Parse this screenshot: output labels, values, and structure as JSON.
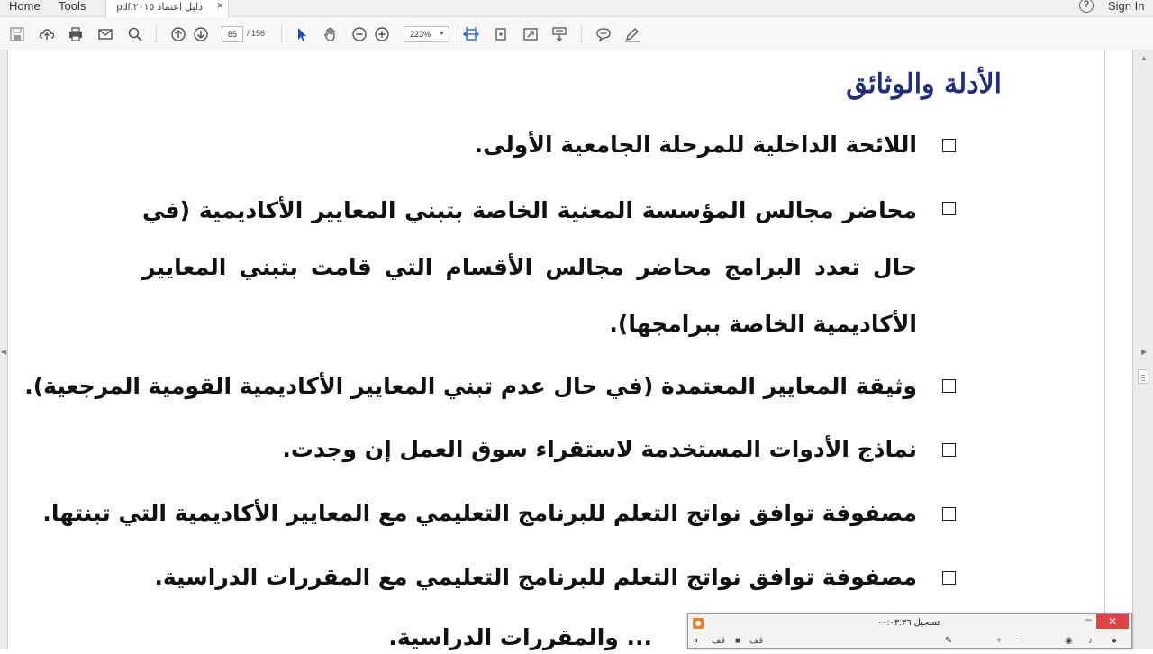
{
  "menubar": {
    "home": "Home",
    "tools": "Tools",
    "tab_title": "دليل اعتماد ٢٠١٥.pdf",
    "tab_close": "×",
    "help": "?",
    "sign_in": "Sign In"
  },
  "toolbar": {
    "page_current": "85",
    "page_total": "/ 156",
    "zoom": "223%",
    "zoom_caret": "▼"
  },
  "document": {
    "heading": "الأدلة والوثائق",
    "items": [
      "اللائحة الداخلية للمرحلة الجامعية الأولى.",
      "محاضر مجالس المؤسسة المعنية الخاصة بتبني المعايير الأكاديمية (في حال تعدد البرامج محاضر مجالس الأقسام التي قامت بتبني المعايير الأكاديمية الخاصة ببرامجها).",
      "وثيقة المعايير المعتمدة (في حال عدم تبني المعايير الأكاديمية القومية المرجعية).",
      "نماذج الأدوات المستخدمة لاستقراء سوق العمل إن وجدت.",
      "مصفوفة توافق نواتج التعلم للبرنامج التعليمي مع المعايير الأكاديمية التي تبنتها.",
      "مصفوفة توافق نواتج التعلم للبرنامج التعليمي مع المقررات الدراسية.",
      "... والمقررات الدراسية."
    ]
  },
  "recorder": {
    "title": "تسجيل ٠٠:٠٣:٣٦",
    "minimize": "–",
    "close": "✕",
    "bar_labels": [
      "قف",
      "قف",
      "+",
      "−"
    ]
  },
  "colors": {
    "heading": "#1f2d7a",
    "recorder_accent": "#f07f1d",
    "close_button": "#e04343"
  }
}
